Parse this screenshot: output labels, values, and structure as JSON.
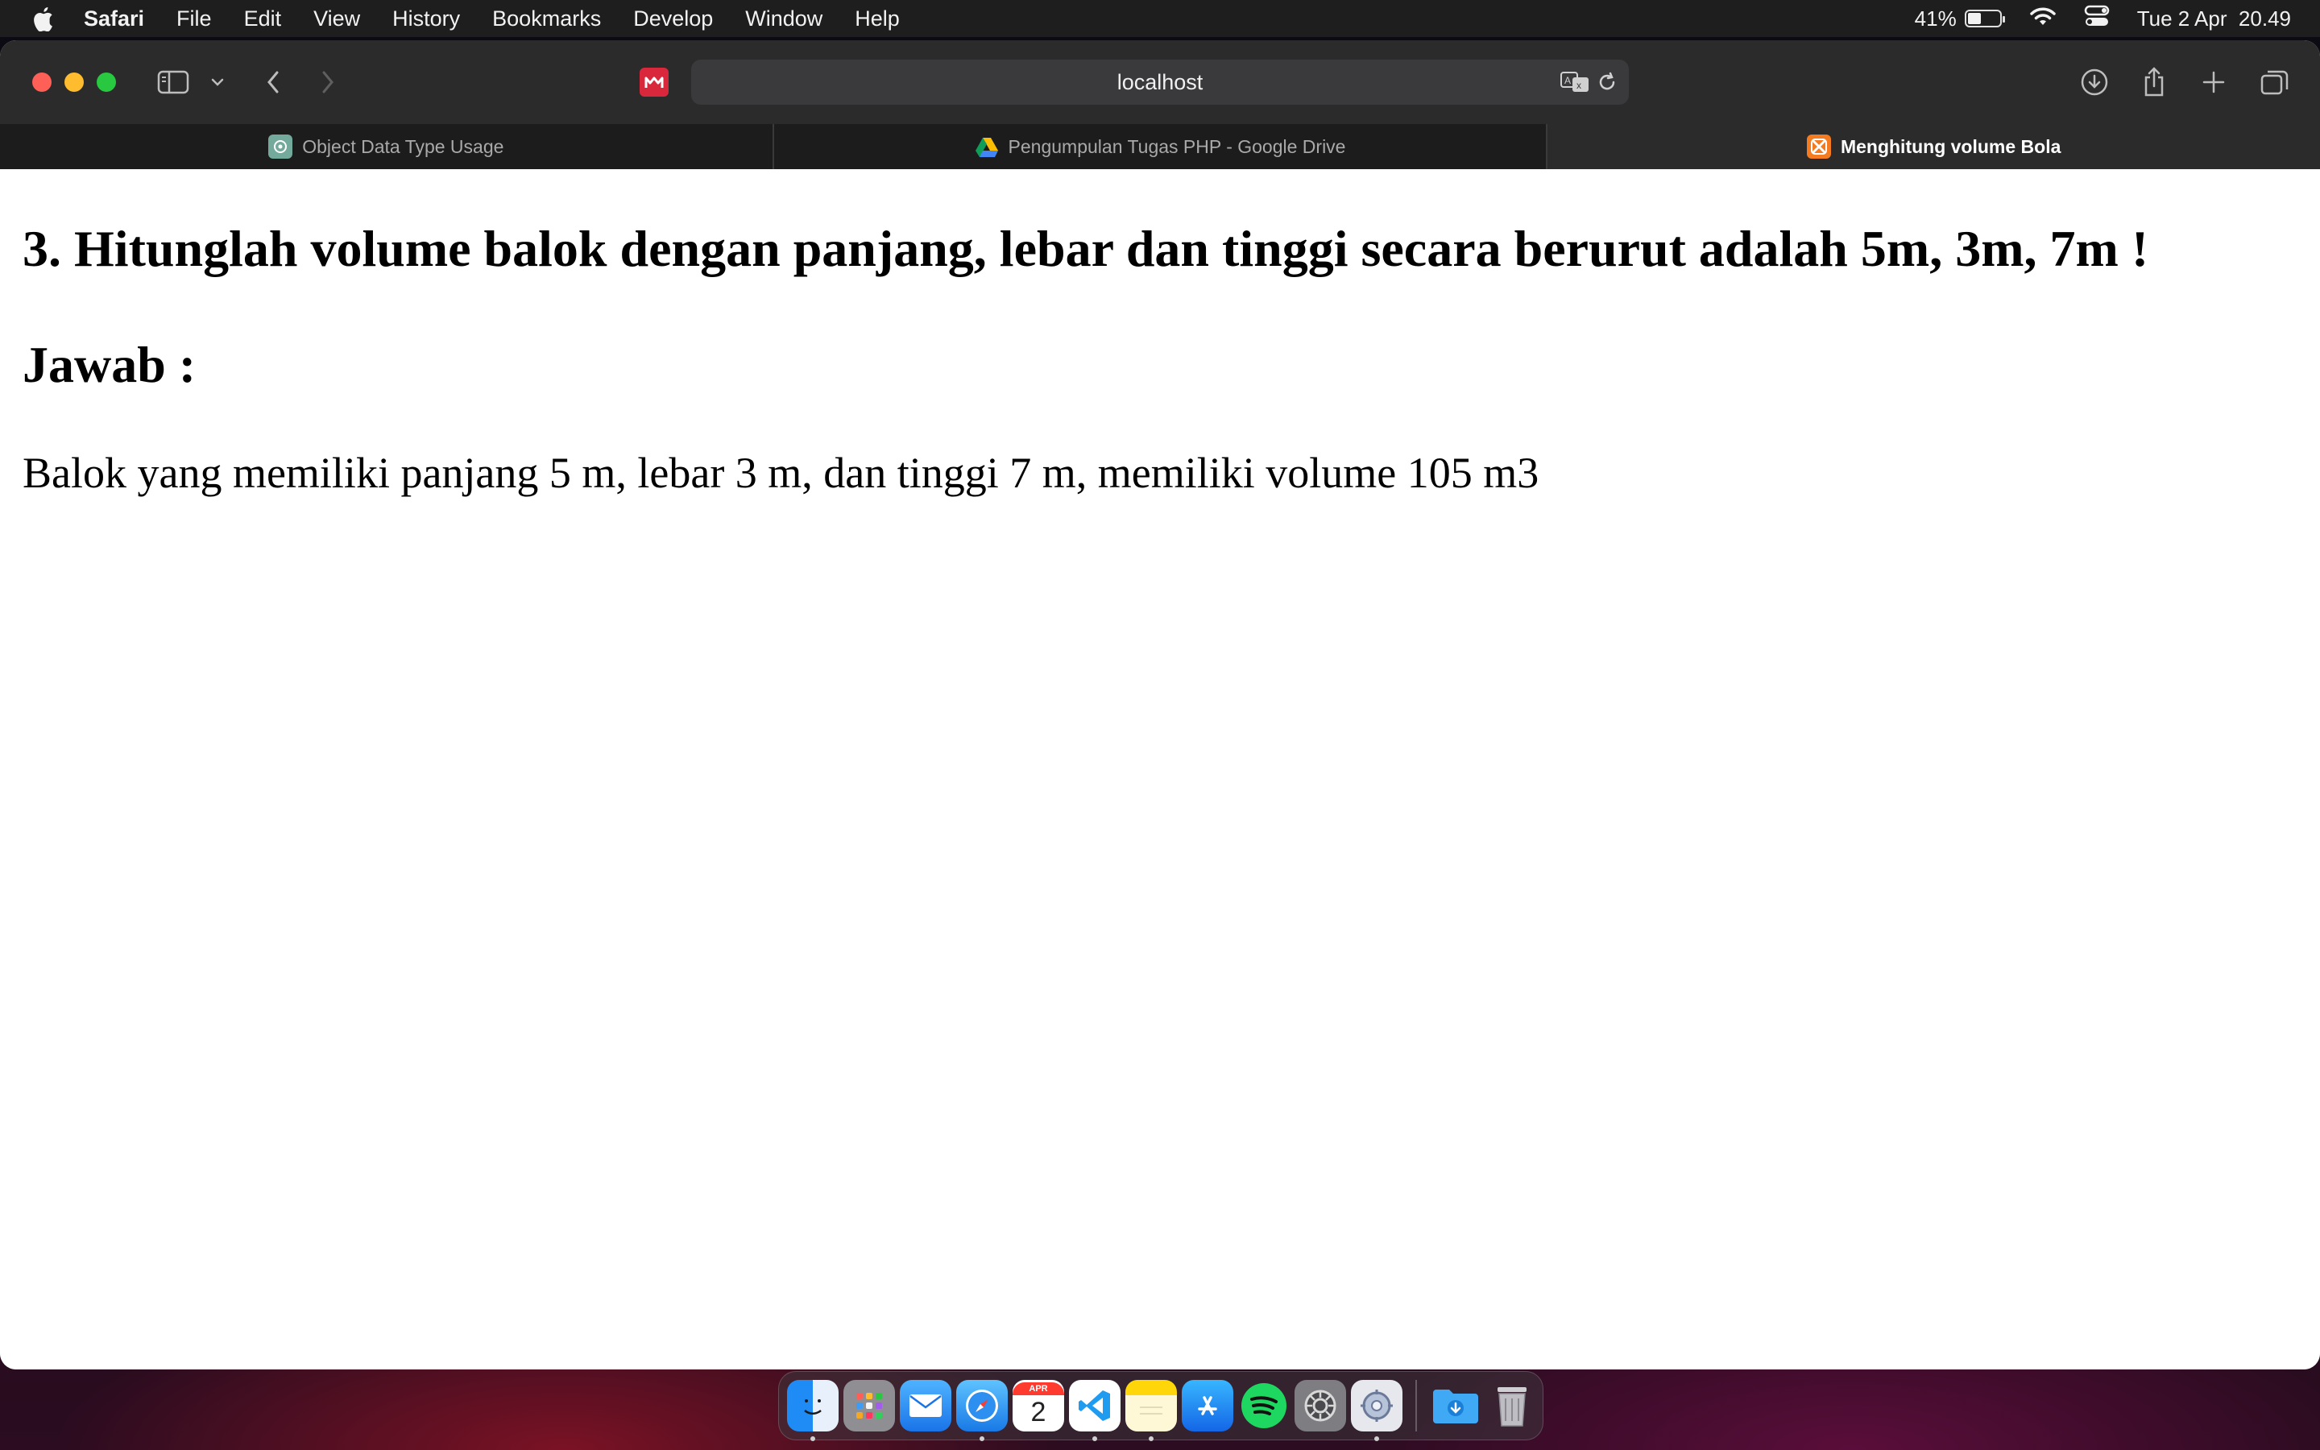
{
  "menubar": {
    "app_name": "Safari",
    "items": [
      "File",
      "Edit",
      "View",
      "History",
      "Bookmarks",
      "Develop",
      "Window",
      "Help"
    ],
    "battery_percent_label": "41%",
    "battery_level": 0.41,
    "datetime": "Tue 2 Apr  20.49"
  },
  "toolbar": {
    "address": "localhost",
    "icons": [
      "sidebar-icon",
      "chevron-down-icon",
      "back-icon",
      "forward-icon",
      "extension-icon",
      "translate-icon",
      "reload-icon",
      "download-icon",
      "share-icon",
      "new-tab-icon",
      "tab-overview-icon"
    ]
  },
  "tabs": [
    {
      "label": "Object Data Type Usage",
      "icon": "chatgpt-icon",
      "active": false
    },
    {
      "label": "Pengumpulan Tugas PHP - Google Drive",
      "icon": "google-drive-icon",
      "active": false
    },
    {
      "label": "Menghitung volume Bola",
      "icon": "xampp-icon",
      "active": true
    }
  ],
  "page": {
    "question": "3. Hitunglah volume balok dengan panjang, lebar dan tinggi secara berurut adalah 5m, 3m, 7m !",
    "answer_heading": "Jawab :",
    "answer_text": "Balok yang memiliki panjang 5 m, lebar 3 m, dan tinggi 7 m, memiliki volume 105 m3"
  },
  "dock": {
    "apps": [
      "finder-icon",
      "launchpad-icon",
      "mail-icon",
      "safari-icon",
      "calendar-icon",
      "vscode-icon",
      "notes-icon",
      "app-store-icon",
      "spotify-icon",
      "system-settings-icon",
      "utility-icon",
      "downloads-folder-icon",
      "trash-icon"
    ],
    "calendar_month": "APR",
    "calendar_day": "2"
  },
  "colors": {
    "menubar_bg": "#1e1e1f",
    "toolbar_bg": "#2b2b2c",
    "close": "#fe5f57",
    "minimize": "#febc2e",
    "maximize": "#28c840"
  }
}
